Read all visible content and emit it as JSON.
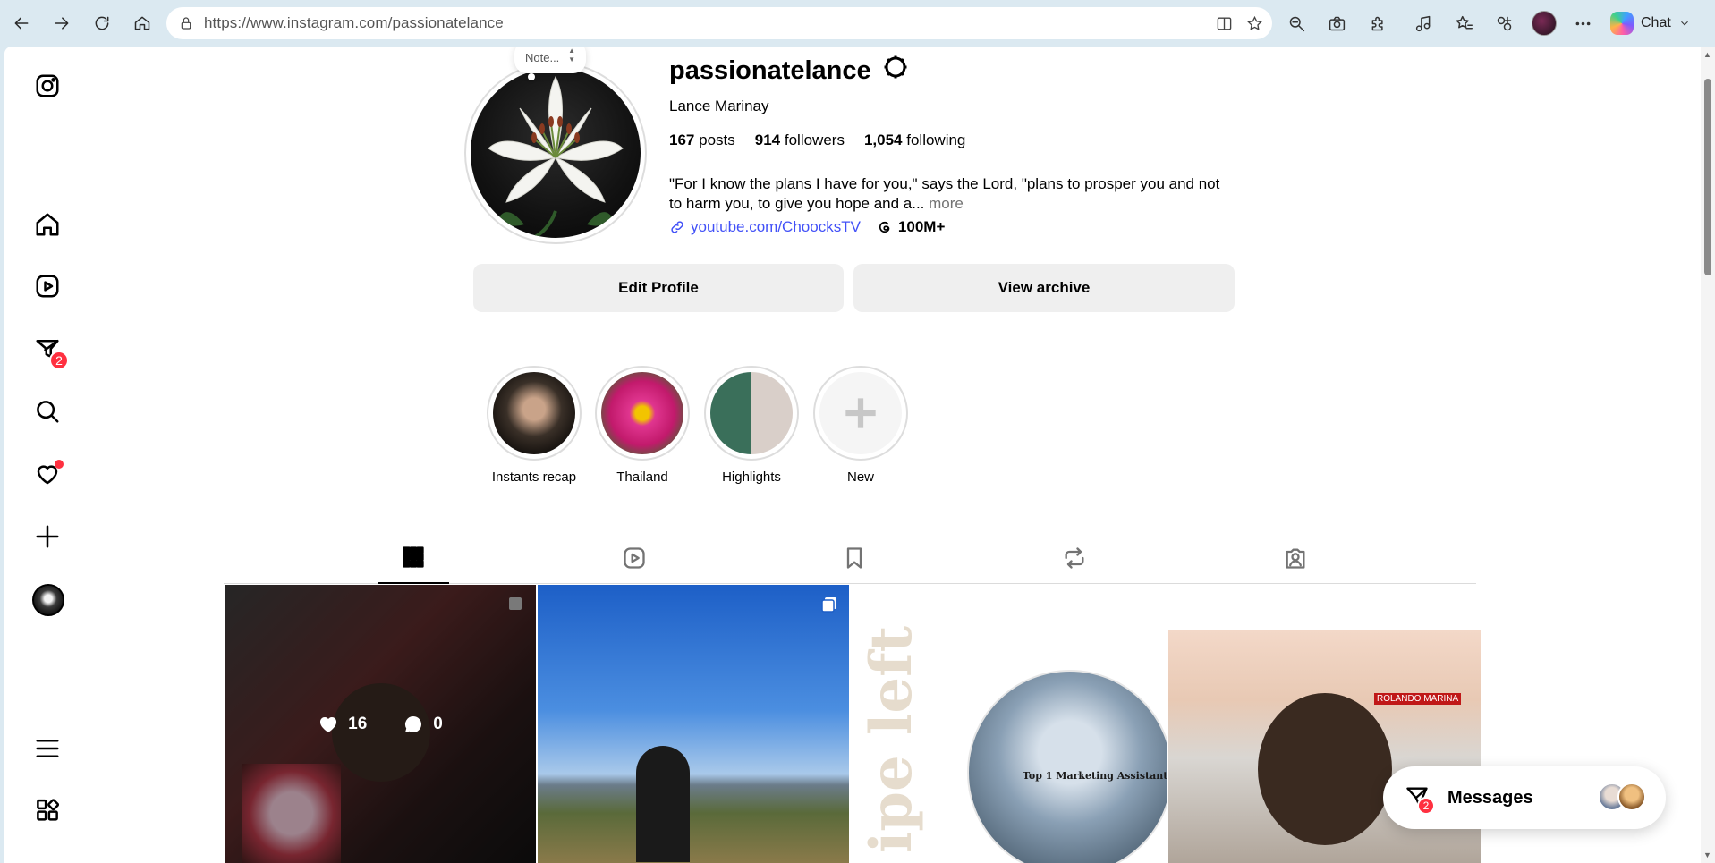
{
  "browser": {
    "url": "https://www.instagram.com/passionatelance",
    "chat_label": "Chat"
  },
  "sidebar": {
    "items": [
      {
        "name": "instagram-logo-icon"
      },
      {
        "name": "home-icon"
      },
      {
        "name": "reels-icon"
      },
      {
        "name": "messages-icon",
        "badge": "2"
      },
      {
        "name": "search-icon"
      },
      {
        "name": "notifications-icon"
      },
      {
        "name": "create-icon"
      },
      {
        "name": "profile-avatar"
      },
      {
        "name": "menu-icon"
      },
      {
        "name": "apps-icon"
      }
    ]
  },
  "profile": {
    "note": "Note...",
    "username": "passionatelance",
    "full_name": "Lance Marinay",
    "posts_count": "167",
    "posts_label": "posts",
    "followers_count": "914",
    "followers_label": "followers",
    "following_count": "1,054",
    "following_label": "following",
    "bio": "\"For I know the plans I have for you,\" says the Lord, \"plans to prosper you and not to harm you, to give you hope and a...",
    "more_label": "more",
    "link": "youtube.com/ChoocksTV",
    "threads_count": "100M+",
    "edit_profile_label": "Edit Profile",
    "view_archive_label": "View archive"
  },
  "highlights": [
    {
      "label": "Instants recap"
    },
    {
      "label": "Thailand"
    },
    {
      "label": "Highlights"
    },
    {
      "label": "New"
    }
  ],
  "posts": [
    {
      "likes": "16",
      "comments": "0"
    }
  ],
  "post_texts": {
    "swipe": "ipe left",
    "badge": "Top 1 Marketing Assistant",
    "nameplate": "ROLANDO MARINA"
  },
  "messages": {
    "label": "Messages",
    "badge": "2"
  },
  "colors": {
    "accent_red": "#ff3040",
    "link_blue": "#4150f7",
    "button_bg": "#efefef"
  }
}
